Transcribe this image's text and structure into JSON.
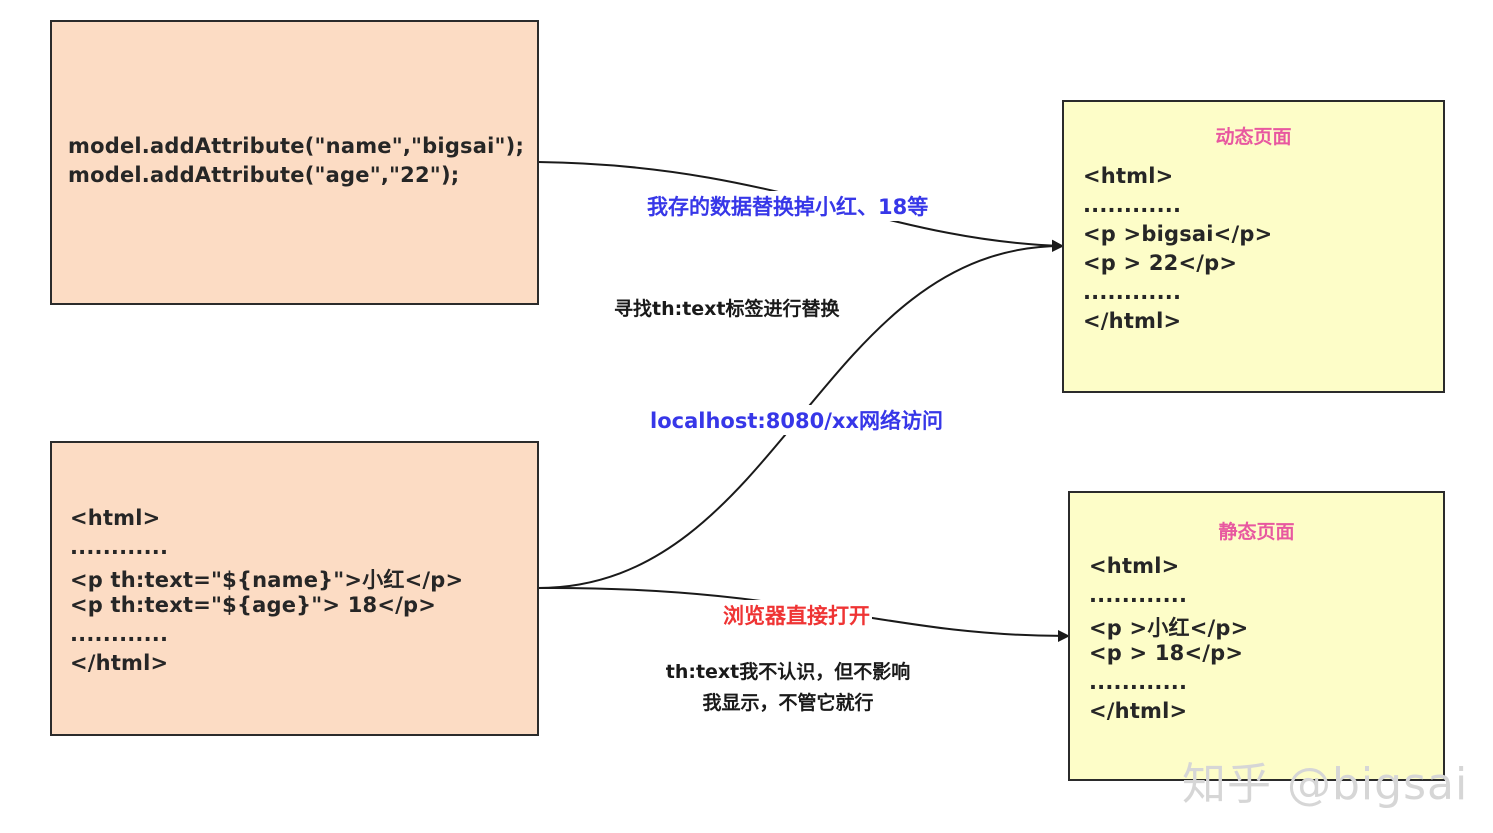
{
  "model_box": {
    "lines": [
      "model.addAttribute(\"name\",\"bigsai\");",
      "model.addAttribute(\"age\",\"22\");"
    ]
  },
  "template_box": {
    "lines": [
      "<html>",
      "............",
      "<p th:text=\"${name}\">小红</p>",
      "<p th:text=\"${age}\"> 18</p>",
      "............",
      "</html>"
    ]
  },
  "dynamic_box": {
    "title": "动态页面",
    "lines": [
      "<html>",
      "............",
      "<p >bigsai</p>",
      "<p > 22</p>",
      "............",
      "</html>"
    ]
  },
  "static_box": {
    "title": "静态页面",
    "lines": [
      "<html>",
      "............",
      "<p >小红</p>",
      "<p > 18</p>",
      "............",
      "</html>"
    ]
  },
  "labels": {
    "replace_data": "我存的数据替换掉小红、18等",
    "find_tag": "寻找th:text标签进行替换",
    "network_access": "localhost:8080/xx网络访问",
    "browser_open": "浏览器直接打开",
    "ignore_line1": "th:text我不认识，但不影响",
    "ignore_line2": "我显示，不管它就行"
  },
  "watermark": "知乎 @bigsai",
  "colors": {
    "orange_box": "#fcdcc4",
    "yellow_box": "#fdfdc8",
    "title_pink": "#e858a0",
    "label_blue": "#3737e8",
    "label_red": "#ef3434"
  }
}
